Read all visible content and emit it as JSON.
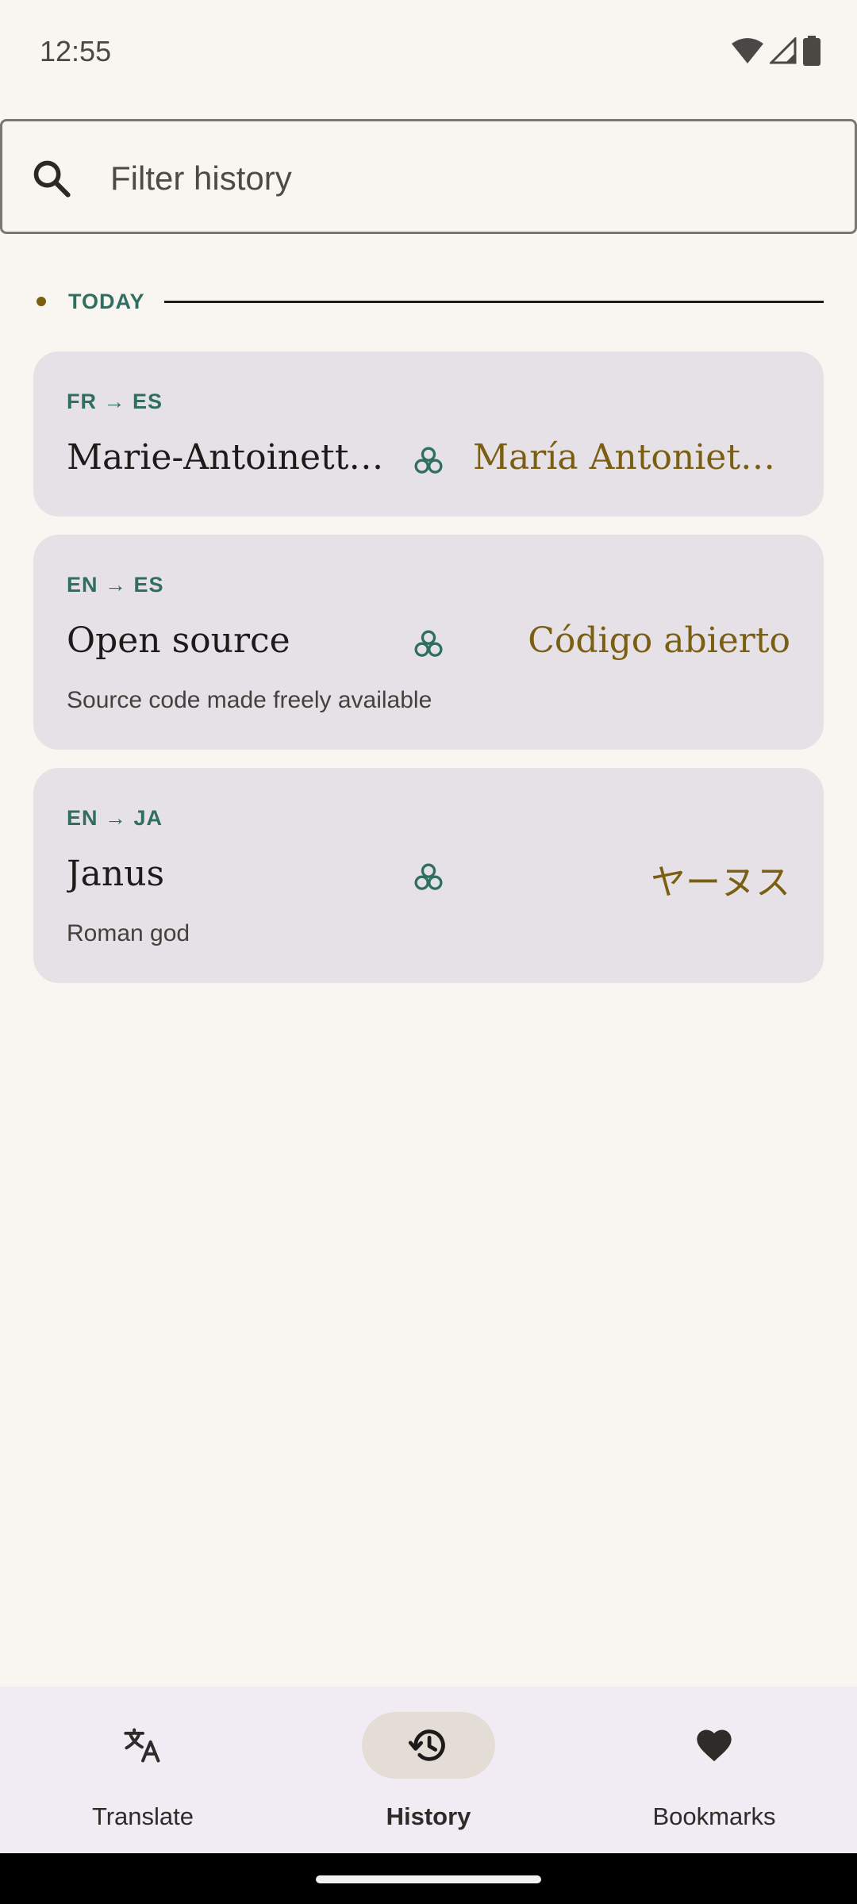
{
  "status_bar": {
    "time": "12:55",
    "icons": [
      "wifi-icon",
      "signal-icon",
      "battery-icon"
    ]
  },
  "search": {
    "placeholder": "Filter history",
    "value": ""
  },
  "section": {
    "label": "TODAY"
  },
  "history": [
    {
      "lang": "FR → ES",
      "source": "Marie-Antoinette ...",
      "target": "María Antonieta ...",
      "description": "",
      "engine_icon": "engine-icon"
    },
    {
      "lang": "EN → ES",
      "source": "Open source",
      "target": "Código abierto",
      "description": "Source code made freely available",
      "engine_icon": "engine-icon"
    },
    {
      "lang": "EN → JA",
      "source": "Janus",
      "target": "ヤーヌス",
      "description": "Roman god",
      "engine_icon": "engine-icon"
    }
  ],
  "nav": {
    "items": [
      {
        "label": "Translate",
        "icon": "translate-icon",
        "active": false
      },
      {
        "label": "History",
        "icon": "history-icon",
        "active": true
      },
      {
        "label": "Bookmarks",
        "icon": "heart-icon",
        "active": false
      }
    ]
  },
  "colors": {
    "background": "#f9f6f1",
    "accent_green": "#2f6f62",
    "accent_gold": "#7a5e12",
    "card": "#e6e1e6",
    "nav_bg": "#f1ecf4",
    "nav_active_pill": "#e4ddd6"
  }
}
